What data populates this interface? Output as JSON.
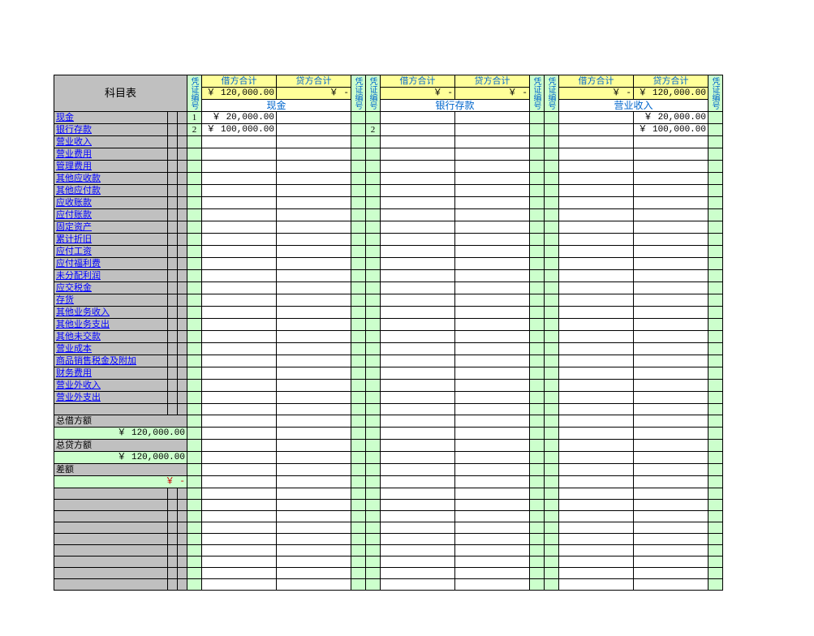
{
  "header": {
    "accounts_title": "科目表",
    "voucher_col": "凭证编号",
    "debit_total_label": "借方合计",
    "credit_total_label": "贷方合计"
  },
  "sections": [
    {
      "name": "现金",
      "debit_total": "￥   120,000.00",
      "credit_total": "￥          -"
    },
    {
      "name": "银行存款",
      "debit_total": "￥          -",
      "credit_total": "￥          -"
    },
    {
      "name": "营业收入",
      "debit_total": "￥          -",
      "credit_total": "￥   120,000.00"
    }
  ],
  "accounts": [
    "现金",
    "银行存款",
    "营业收入",
    "营业费用",
    "管理费用",
    "其他应收款",
    "其他应付款",
    "应收账款",
    "应付账款",
    "固定资产",
    "累计折旧",
    "应付工资",
    "应付福利费",
    "未分配利润",
    "应交税金",
    "存货",
    "其他业务收入",
    "其他业务支出",
    "其他未交款",
    "营业成本",
    "商品销售税金及附加",
    "财务费用",
    "营业外收入",
    "营业外支出"
  ],
  "data_rows": [
    {
      "voucher_a": "1",
      "sec1_debit": "￥    20,000.00",
      "sec1_credit": "",
      "voucher_b": "",
      "voucher_c": "",
      "sec2_debit": "",
      "sec2_credit": "",
      "voucher_d": "",
      "voucher_e": "",
      "sec3_debit": "",
      "sec3_credit": "￥    20,000.00"
    },
    {
      "voucher_a": "2",
      "sec1_debit": "￥   100,000.00",
      "sec1_credit": "",
      "voucher_b": "",
      "voucher_c": "2",
      "sec2_debit": "",
      "sec2_credit": "",
      "voucher_d": "",
      "voucher_e": "",
      "sec3_debit": "",
      "sec3_credit": "￥   100,000.00"
    }
  ],
  "summary": {
    "total_debit_label": "总借方额",
    "total_debit_value": "￥        120,000.00",
    "total_credit_label": "总贷方额",
    "total_credit_value": "￥        120,000.00",
    "diff_label": "差额",
    "diff_value": "￥              -"
  },
  "blank_rows_before_summary": 1,
  "grid_total_rows": 44
}
